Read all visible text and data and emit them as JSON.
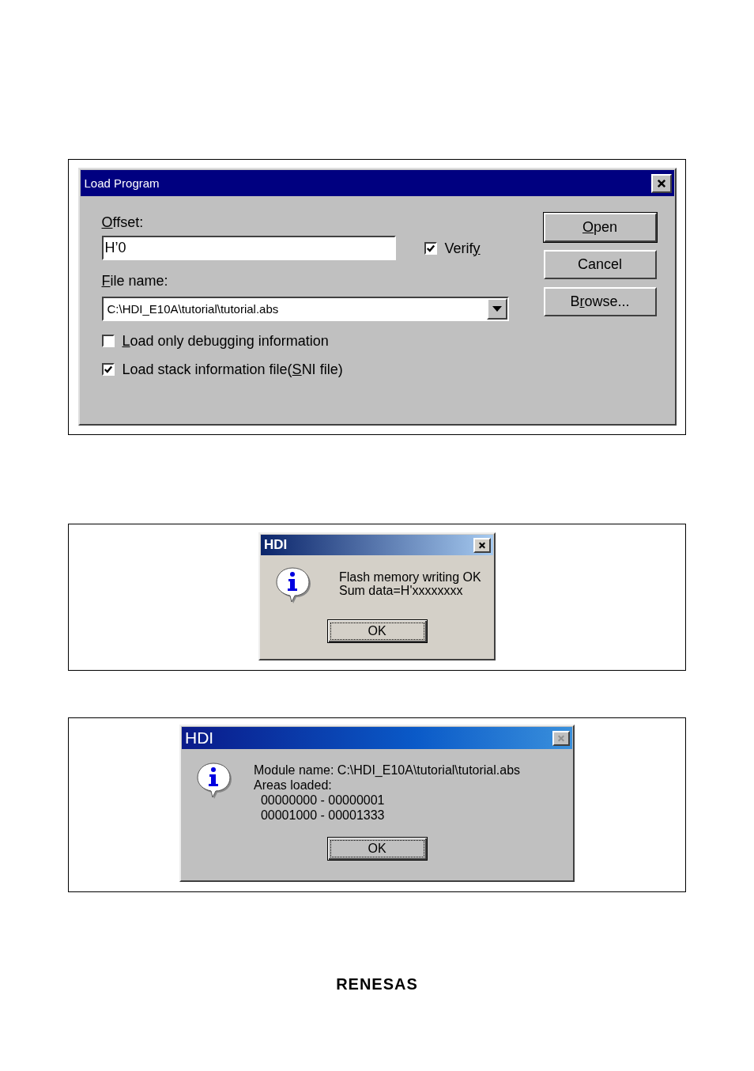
{
  "load_dialog": {
    "title": "Load Program",
    "offset": {
      "label": {
        "key": "O",
        "after": "ffset:"
      },
      "value": "H’0"
    },
    "verify": {
      "label": {
        "before": "Verif",
        "key": "y"
      },
      "checked": true
    },
    "file_name": {
      "label": {
        "key": "F",
        "after": "ile  name:"
      },
      "value": "C:\\HDI_E10A\\tutorial\\tutorial.abs"
    },
    "options": [
      {
        "label": {
          "key": "L",
          "after": "oad only debugging information"
        },
        "checked": false
      },
      {
        "label": {
          "before": "Load stack information file(",
          "key": "S",
          "after": "NI file)"
        },
        "checked": true
      }
    ],
    "buttons": [
      {
        "label": {
          "key": "O",
          "after": "pen"
        },
        "default": true
      },
      {
        "label": {
          "before": "Cancel"
        },
        "default": false
      },
      {
        "label": {
          "before": "B",
          "key": "r",
          "after": "owse..."
        },
        "default": false
      }
    ]
  },
  "message_dialogs": [
    {
      "kind": "classic",
      "title": "HDI",
      "close_disabled": false,
      "lines": [
        {
          "text": "Flash memory writing OK"
        },
        {
          "text": "Sum data=H'xxxxxxxx"
        }
      ],
      "button": "OK"
    },
    {
      "kind": "gradient",
      "title": "HDI",
      "close_disabled": true,
      "lines": [
        {
          "text": "Module name: C:\\HDI_E10A\\tutorial\\tutorial.abs"
        },
        {
          "text": "Areas loaded:"
        },
        {
          "text": "  00000000 - 00000001"
        },
        {
          "text": "  00001000 - 00001333"
        }
      ],
      "button": "OK"
    }
  ],
  "footer": {
    "logo": "RENESAS"
  }
}
